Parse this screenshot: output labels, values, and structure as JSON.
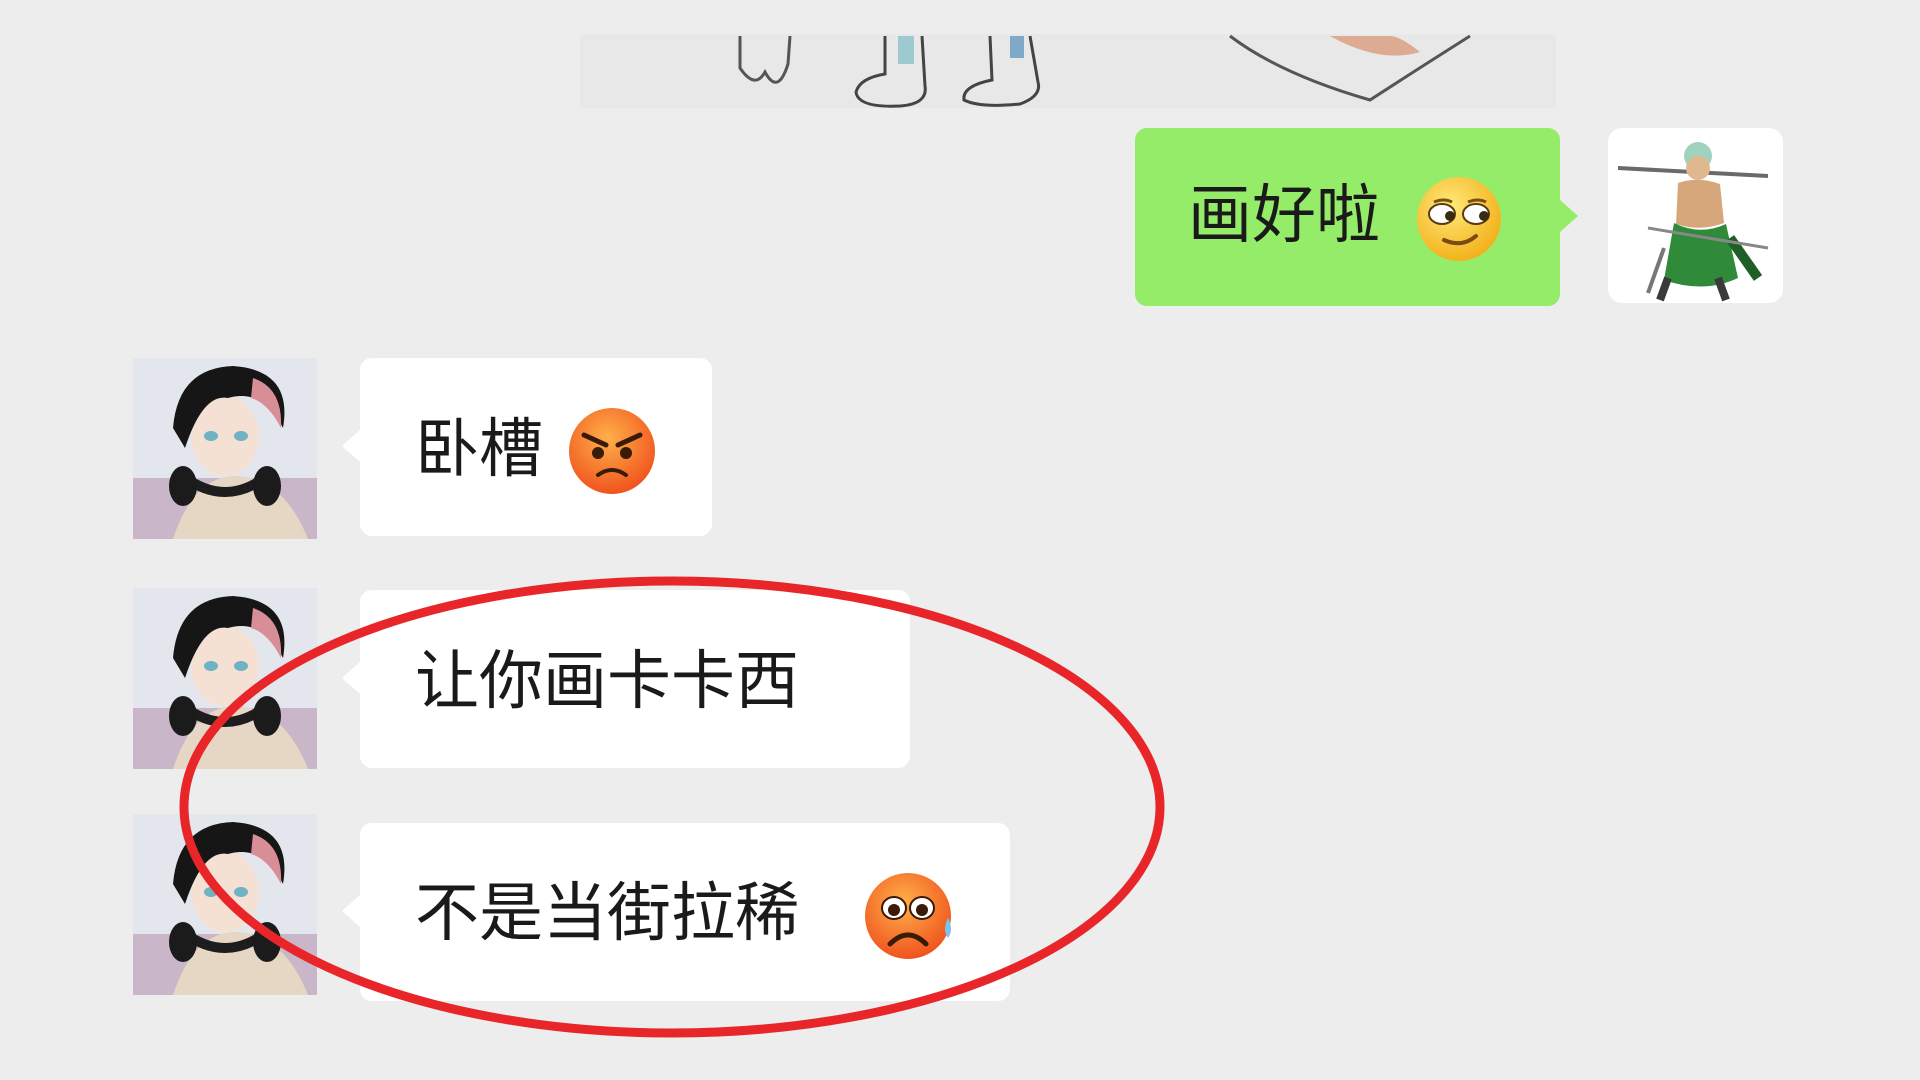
{
  "chat": {
    "background_color": "#ededed",
    "messages": [
      {
        "id": "top-image",
        "direction": "outgoing",
        "type": "image",
        "content": "hand-drawn sketch (partially visible)"
      },
      {
        "id": "msg-1",
        "direction": "outgoing",
        "text": "画好啦",
        "emoji": "smirk-emoji",
        "bubble_color": "#95ec69"
      },
      {
        "id": "msg-2",
        "direction": "incoming",
        "text": "卧槽",
        "emoji": "angry-emoji",
        "bubble_color": "#ffffff"
      },
      {
        "id": "msg-3",
        "direction": "incoming",
        "text": "让你画卡卡西",
        "bubble_color": "#ffffff"
      },
      {
        "id": "msg-4",
        "direction": "incoming",
        "text": "不是当街拉稀",
        "emoji": "sweat-frown-emoji",
        "bubble_color": "#ffffff"
      }
    ]
  },
  "avatars": {
    "me": "swordsman-avatar",
    "contact": "anime-boy-headphones-avatar"
  },
  "annotation": {
    "shape": "ellipse",
    "color": "#e8262a"
  }
}
